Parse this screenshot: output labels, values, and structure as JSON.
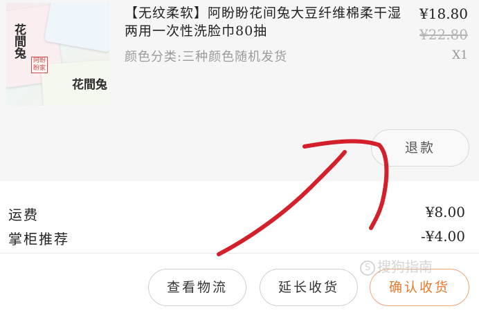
{
  "product": {
    "title": "【无纹柔软】阿盼盼花间兔大豆纤维棉柔干湿两用一次性洗脸巾80抽",
    "spec": "颜色分类:三种颜色随机发货",
    "price": "¥18.80",
    "original_price": "¥22.80",
    "quantity": "X1",
    "image": {
      "pack_text_vertical": "花間兔",
      "pack_text_bottom": "花間兔",
      "seal": "阿盼盼家"
    }
  },
  "refund_button": {
    "label": "退款"
  },
  "summary": {
    "shipping_label": "运费",
    "shipping_value": "¥8.00",
    "recommend_label": "掌柜推荐",
    "recommend_value": "-¥4.00"
  },
  "actions": {
    "logistics_label": "查看物流",
    "extend_label": "延长收货",
    "confirm_label": "确认收货"
  },
  "watermark": {
    "symbol": "S",
    "text": "搜狗指南"
  },
  "colors": {
    "accent": "#e8792e",
    "annotation": "#d3202a"
  }
}
